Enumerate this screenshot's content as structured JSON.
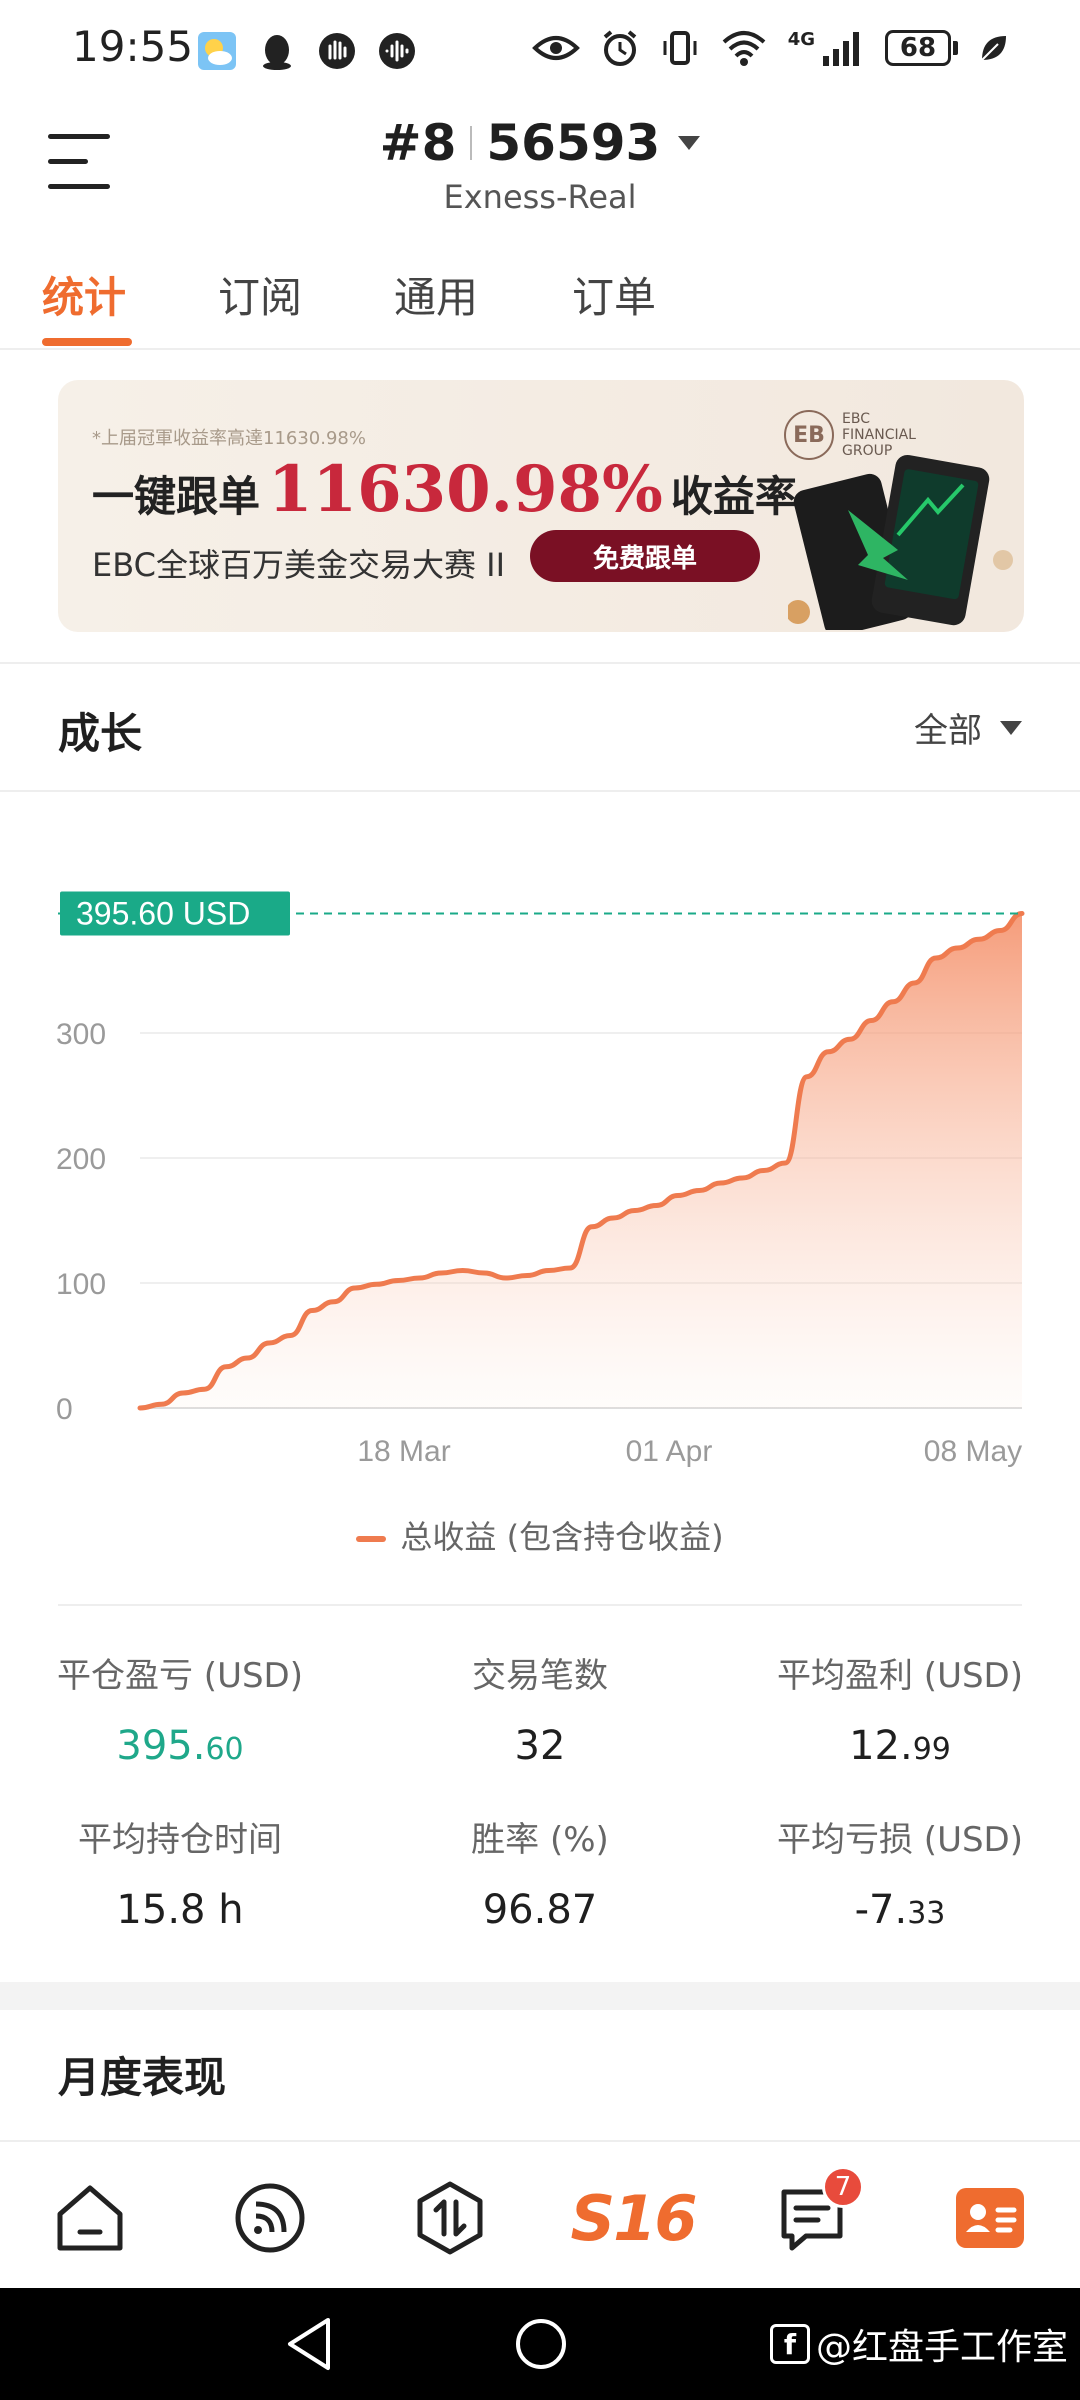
{
  "status_bar": {
    "time": "19:55",
    "network": "4G",
    "battery": "68"
  },
  "header": {
    "rank": "#8",
    "account": "56593",
    "server": "Exness-Real"
  },
  "tabs": [
    {
      "label": "统计",
      "active": true
    },
    {
      "label": "订阅",
      "active": false
    },
    {
      "label": "通用",
      "active": false
    },
    {
      "label": "订单",
      "active": false
    }
  ],
  "banner": {
    "note": "*上届冠軍收益率高達11630.98%",
    "headline_prefix": "一键跟单",
    "headline_value": "11630.98%",
    "headline_suffix": "收益率",
    "subtitle": "EBC全球百万美金交易大赛 II",
    "cta": "免费跟单",
    "logo_mark": "EB",
    "logo_text_1": "EBC",
    "logo_text_2": "FINANCIAL",
    "logo_text_3": "GROUP"
  },
  "growth": {
    "title": "成长",
    "filter": "全部"
  },
  "chart_data": {
    "type": "area",
    "current_label": "395.60 USD",
    "y_ticks": [
      "0",
      "100",
      "200",
      "300"
    ],
    "ylim": [
      0,
      400
    ],
    "x_ticks": [
      "18 Mar",
      "01 Apr",
      "08 May"
    ],
    "series": [
      {
        "name": "总收益 (包含持仓收益)",
        "color": "#ef7b4f",
        "values": [
          0,
          3,
          12,
          15,
          33,
          40,
          52,
          58,
          78,
          85,
          96,
          99,
          102,
          104,
          108,
          110,
          108,
          104,
          106,
          110,
          112,
          145,
          152,
          158,
          162,
          170,
          174,
          180,
          184,
          190,
          196,
          265,
          285,
          295,
          310,
          325,
          340,
          360,
          368,
          375,
          382,
          395.6
        ]
      }
    ]
  },
  "legend": {
    "label": "总收益 (包含持仓收益)"
  },
  "stats": {
    "closed_pl": {
      "label": "平仓盈亏 (USD)",
      "int": "395.",
      "dec": "60"
    },
    "trades": {
      "label": "交易笔数",
      "value": "32"
    },
    "avg_profit": {
      "label": "平均盈利 (USD)",
      "int": "12.",
      "dec": "99"
    },
    "avg_hold": {
      "label": "平均持仓时间",
      "value": "15.8 h"
    },
    "win_rate": {
      "label": "胜率 (%)",
      "value": "96.87"
    },
    "avg_loss": {
      "label": "平均亏损 (USD)",
      "int": "-7.",
      "dec": "33"
    }
  },
  "monthly": {
    "title": "月度表现"
  },
  "bottom_nav": {
    "brand": "S16",
    "messages_badge": "7"
  },
  "watermark": {
    "text": "@红盘手工作室"
  },
  "colors": {
    "accent": "#ef6c2f",
    "positive": "#1fa88a",
    "chart_line": "#ef7b4f",
    "tag": "#1aaa88"
  }
}
